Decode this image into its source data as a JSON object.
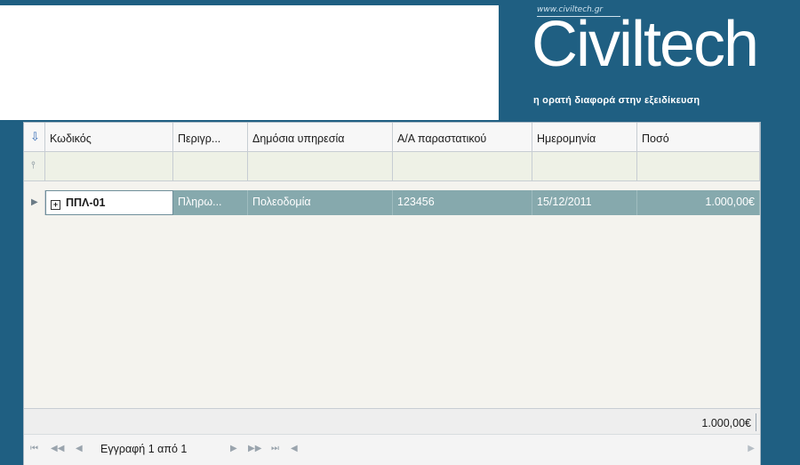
{
  "logo": {
    "url": "www.civiltech.gr",
    "wordmark": "Civiltech",
    "tagline": "η ορατή διαφορά στην εξειδίκευση"
  },
  "grid": {
    "columns": [
      "Κωδικός",
      "Περιγρ...",
      "Δημόσια υπηρεσία",
      "Α/Α παραστατικού",
      "Ημερομηνία",
      "Ποσό"
    ],
    "rows": [
      {
        "code": "ΠΠΛ-01",
        "description": "Πληρω...",
        "service": "Πολεοδομία",
        "doc_no": "123456",
        "date": "15/12/2011",
        "amount": "1.000,00€"
      }
    ],
    "footer_total": "1.000,00€",
    "navigator": {
      "record_text": "Εγγραφή 1 από 1"
    }
  },
  "colors": {
    "brand": "#1f5f82",
    "selected_row": "#86a9ad"
  }
}
